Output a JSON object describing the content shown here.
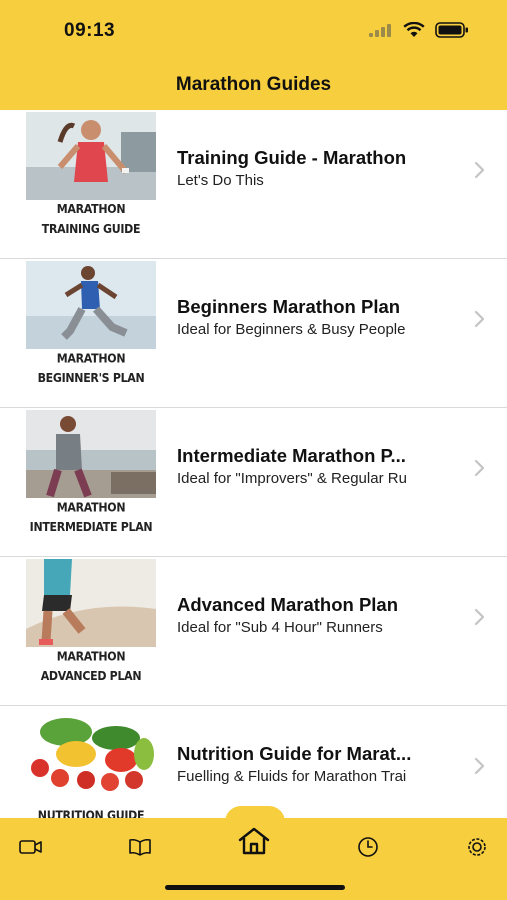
{
  "status_bar": {
    "time": "09:13",
    "icons": [
      "signal-icon",
      "wifi-icon",
      "battery-icon"
    ]
  },
  "nav": {
    "title": "Marathon Guides"
  },
  "colors": {
    "accent": "#F7CE3E",
    "text": "#111111",
    "chevron": "#c4c4c4"
  },
  "items": [
    {
      "title": "Training Guide - Marathon",
      "subtitle": "Let's Do This",
      "caption_line1": "MARATHON",
      "caption_line2": "TRAINING GUIDE"
    },
    {
      "title": "Beginners Marathon Plan",
      "subtitle": "Ideal for Beginners & Busy People",
      "caption_line1": "MARATHON",
      "caption_line2": "BEGINNER'S PLAN"
    },
    {
      "title": "Intermediate Marathon P...",
      "subtitle": "Ideal for \"Improvers\" & Regular Ru",
      "caption_line1": "MARATHON",
      "caption_line2": "INTERMEDIATE PLAN"
    },
    {
      "title": "Advanced Marathon Plan",
      "subtitle": "Ideal for \"Sub 4 Hour\" Runners",
      "caption_line1": "MARATHON",
      "caption_line2": "ADVANCED PLAN"
    },
    {
      "title": "Nutrition Guide for Marat...",
      "subtitle": "Fuelling & Fluids for Marathon Trai",
      "caption_line1": "NUTRITION GUIDE",
      "caption_line2": ""
    }
  ],
  "tabs": [
    {
      "name": "video-icon"
    },
    {
      "name": "book-icon"
    },
    {
      "name": "home-icon",
      "selected": true
    },
    {
      "name": "clock-icon"
    },
    {
      "name": "settings-icon"
    }
  ]
}
